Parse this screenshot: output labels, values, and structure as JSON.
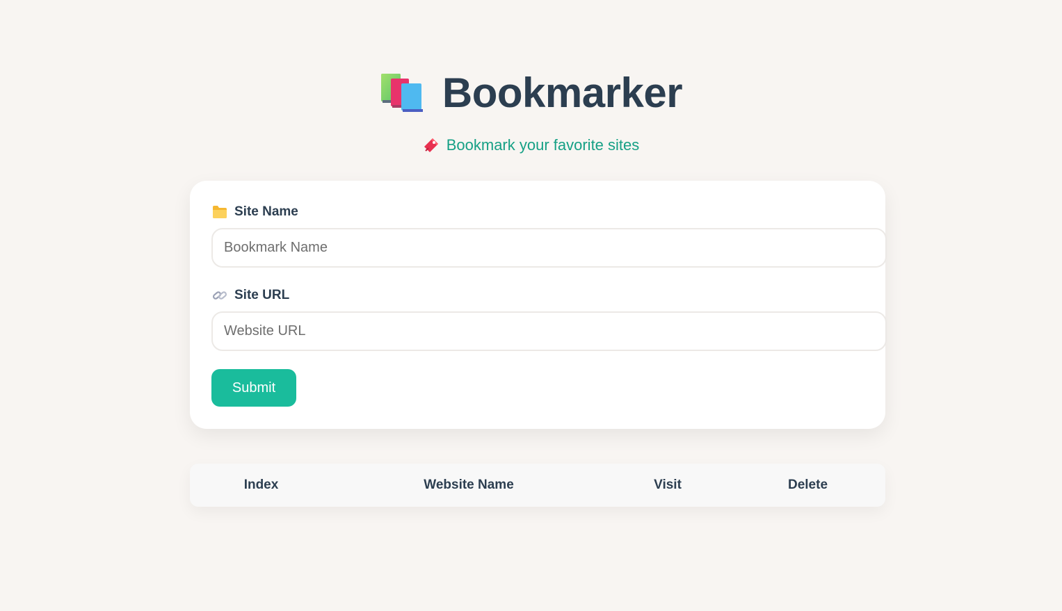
{
  "header": {
    "title": "Bookmarker",
    "logo_icon": "books-icon"
  },
  "tagline": {
    "text": "Bookmark your favorite sites",
    "icon": "bookmark-tag-icon",
    "color": "#16a085"
  },
  "form": {
    "site_name": {
      "label": "Site Name",
      "icon": "folder-icon",
      "placeholder": "Bookmark Name",
      "value": ""
    },
    "site_url": {
      "label": "Site URL",
      "icon": "link-icon",
      "placeholder": "Website URL",
      "value": ""
    },
    "submit_label": "Submit",
    "submit_color": "#1abc9c"
  },
  "table": {
    "columns": [
      "Index",
      "Website Name",
      "Visit",
      "Delete"
    ],
    "rows": []
  },
  "colors": {
    "background": "#f8f5f2",
    "text": "#2c3e50",
    "card": "#ffffff"
  }
}
